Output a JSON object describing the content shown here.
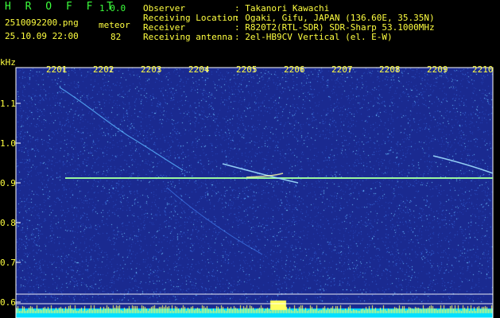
{
  "header": {
    "app_name": "H R O F F T",
    "version": "1.0.0",
    "filename": "2510092200.png",
    "datetime": "25.10.09 22:00",
    "mode_label": "meteor",
    "count": "82",
    "info": [
      {
        "label": "Observer",
        "value": ": Takanori Kawachi"
      },
      {
        "label": "Receiving Location",
        "value": ": Ogaki, Gifu, JAPAN (136.60E, 35.35N)"
      },
      {
        "label": "Receiver",
        "value": ": R820T2(RTL-SDR) SDR-Sharp 53.1000MHz"
      },
      {
        "label": "Receiving antenna",
        "value": ": 2el-HB9CV Vertical (el. E-W)"
      }
    ]
  },
  "spectrogram": {
    "y_unit": "kHz",
    "y_ticks": [
      "1.1",
      "1.0",
      "0.9",
      "0.8",
      "0.7",
      "0.6"
    ],
    "x_ticks": [
      "2201",
      "2202",
      "2203",
      "2204",
      "2205",
      "2206",
      "2207",
      "2208",
      "2209",
      "2210"
    ],
    "colors": {
      "background": "#1a2a90",
      "carrier": "#a0ffa0",
      "noise_floor": "#00e0ff",
      "text": "#ffff40"
    }
  }
}
